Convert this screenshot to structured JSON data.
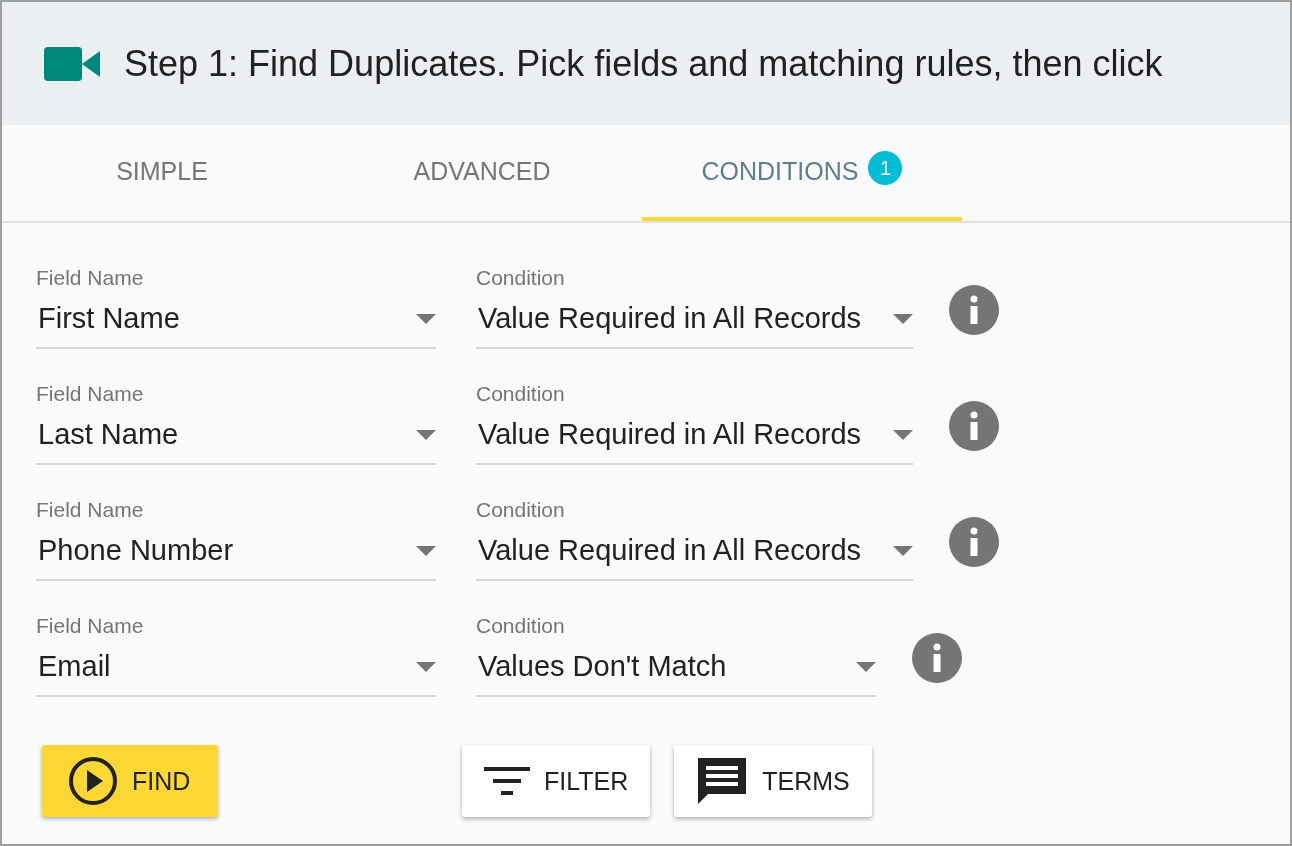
{
  "header": {
    "title": "Step 1: Find Duplicates. Pick fields and matching rules, then click"
  },
  "tabs": [
    {
      "label": "SIMPLE",
      "selected": false
    },
    {
      "label": "ADVANCED",
      "selected": false
    },
    {
      "label": "CONDITIONS",
      "selected": true,
      "badge": "1"
    }
  ],
  "rows": [
    {
      "field_label": "Field Name",
      "field": "First Name",
      "condition_label": "Condition",
      "condition": "Value Required in All Records"
    },
    {
      "field_label": "Field Name",
      "field": "Last Name",
      "condition_label": "Condition",
      "condition": "Value Required in All Records"
    },
    {
      "field_label": "Field Name",
      "field": "Phone Number",
      "condition_label": "Condition",
      "condition": "Value Required in All Records"
    },
    {
      "field_label": "Field Name",
      "field": "Email",
      "condition_label": "Condition",
      "condition": "Values Don't Match"
    }
  ],
  "buttons": [
    {
      "kind": "find",
      "label": "FIND"
    },
    {
      "kind": "filter",
      "label": "FILTER"
    },
    {
      "kind": "terms",
      "label": "TERMS"
    }
  ]
}
